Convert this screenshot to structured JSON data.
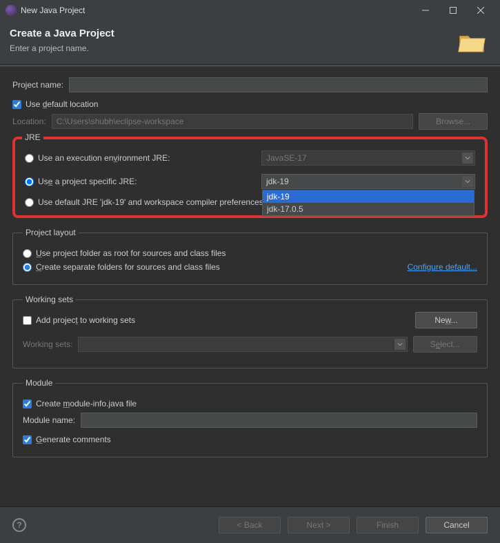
{
  "titlebar": {
    "title": "New Java Project"
  },
  "header": {
    "title": "Create a Java Project",
    "subtitle": "Enter a project name."
  },
  "project": {
    "name_label": "Project name:",
    "name_value": "",
    "use_default_location_label": "Use default location",
    "use_default_location": true,
    "location_label": "Location:",
    "location_value": "C:\\Users\\shubh\\eclipse-workspace",
    "browse_label": "Browse..."
  },
  "jre": {
    "legend": "JRE",
    "option_env_label": "Use an execution environment JRE:",
    "env_value": "JavaSE-17",
    "option_specific_label": "Use a project specific JRE:",
    "specific_value": "jdk-19",
    "specific_options": [
      "jdk-19",
      "jdk-17.0.5"
    ],
    "option_default_label": "Use default JRE 'jdk-19' and workspace compiler preferences",
    "selected": "specific"
  },
  "layout": {
    "legend": "Project layout",
    "option_root_label": "Use project folder as root for sources and class files",
    "option_separate_label": "Create separate folders for sources and class files",
    "selected": "separate",
    "configure_link": "Configure default..."
  },
  "working_sets": {
    "legend": "Working sets",
    "add_label": "Add project to working sets",
    "add_checked": false,
    "new_label": "New...",
    "field_label": "Working sets:",
    "select_label": "Select..."
  },
  "module": {
    "legend": "Module",
    "create_label": "Create module-info.java file",
    "create_checked": true,
    "name_label": "Module name:",
    "name_value": "",
    "generate_label": "Generate comments",
    "generate_checked": true
  },
  "buttons": {
    "back": "< Back",
    "next": "Next >",
    "finish": "Finish",
    "cancel": "Cancel"
  }
}
